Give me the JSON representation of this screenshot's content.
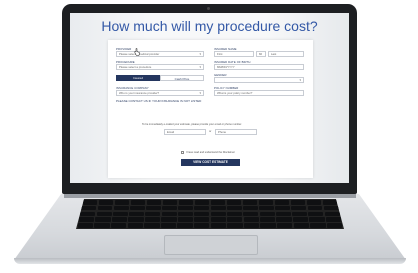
{
  "page": {
    "title": "How much will my procedure cost?"
  },
  "form": {
    "provider_label": "PROVIDER",
    "provider_placeholder": "Please select a medical provider",
    "insured_name_label": "INSURED NAME",
    "first_placeholder": "First",
    "mi_placeholder": "MI",
    "last_placeholder": "Last",
    "procedure_label": "PROCEDURE",
    "procedure_placeholder": "Please select a procedure",
    "dob_label": "INSURED DATE OF BIRTH",
    "dob_placeholder": "MM/DD/YYYY",
    "toggle_insured": "Insured",
    "toggle_cash": "Cash Price",
    "gender_label": "GENDER",
    "insurance_label": "INSURANCE COMPANY",
    "insurance_placeholder": "Who is your insurance provider?",
    "policy_label": "POLICY NUMBER",
    "policy_placeholder": "What is your policy number?",
    "contact_note": "PLEASE CONTACT US IF YOUR INSURANCE IS NOT LISTED",
    "email_phone_note": "To be immediately e-mailed your estimate, please provide your email or phone number.",
    "email_placeholder": "Email",
    "or_text": "or",
    "phone_placeholder": "Phone",
    "agree_text": "I have read and understand the Disclaimer",
    "cta_label": "VIEW COST ESTIMATE"
  },
  "icons": {
    "cursor": "hand-pointer-icon",
    "caret": "chevron-down-icon"
  },
  "colors": {
    "title": "#3358a6",
    "primary": "#24365f"
  }
}
